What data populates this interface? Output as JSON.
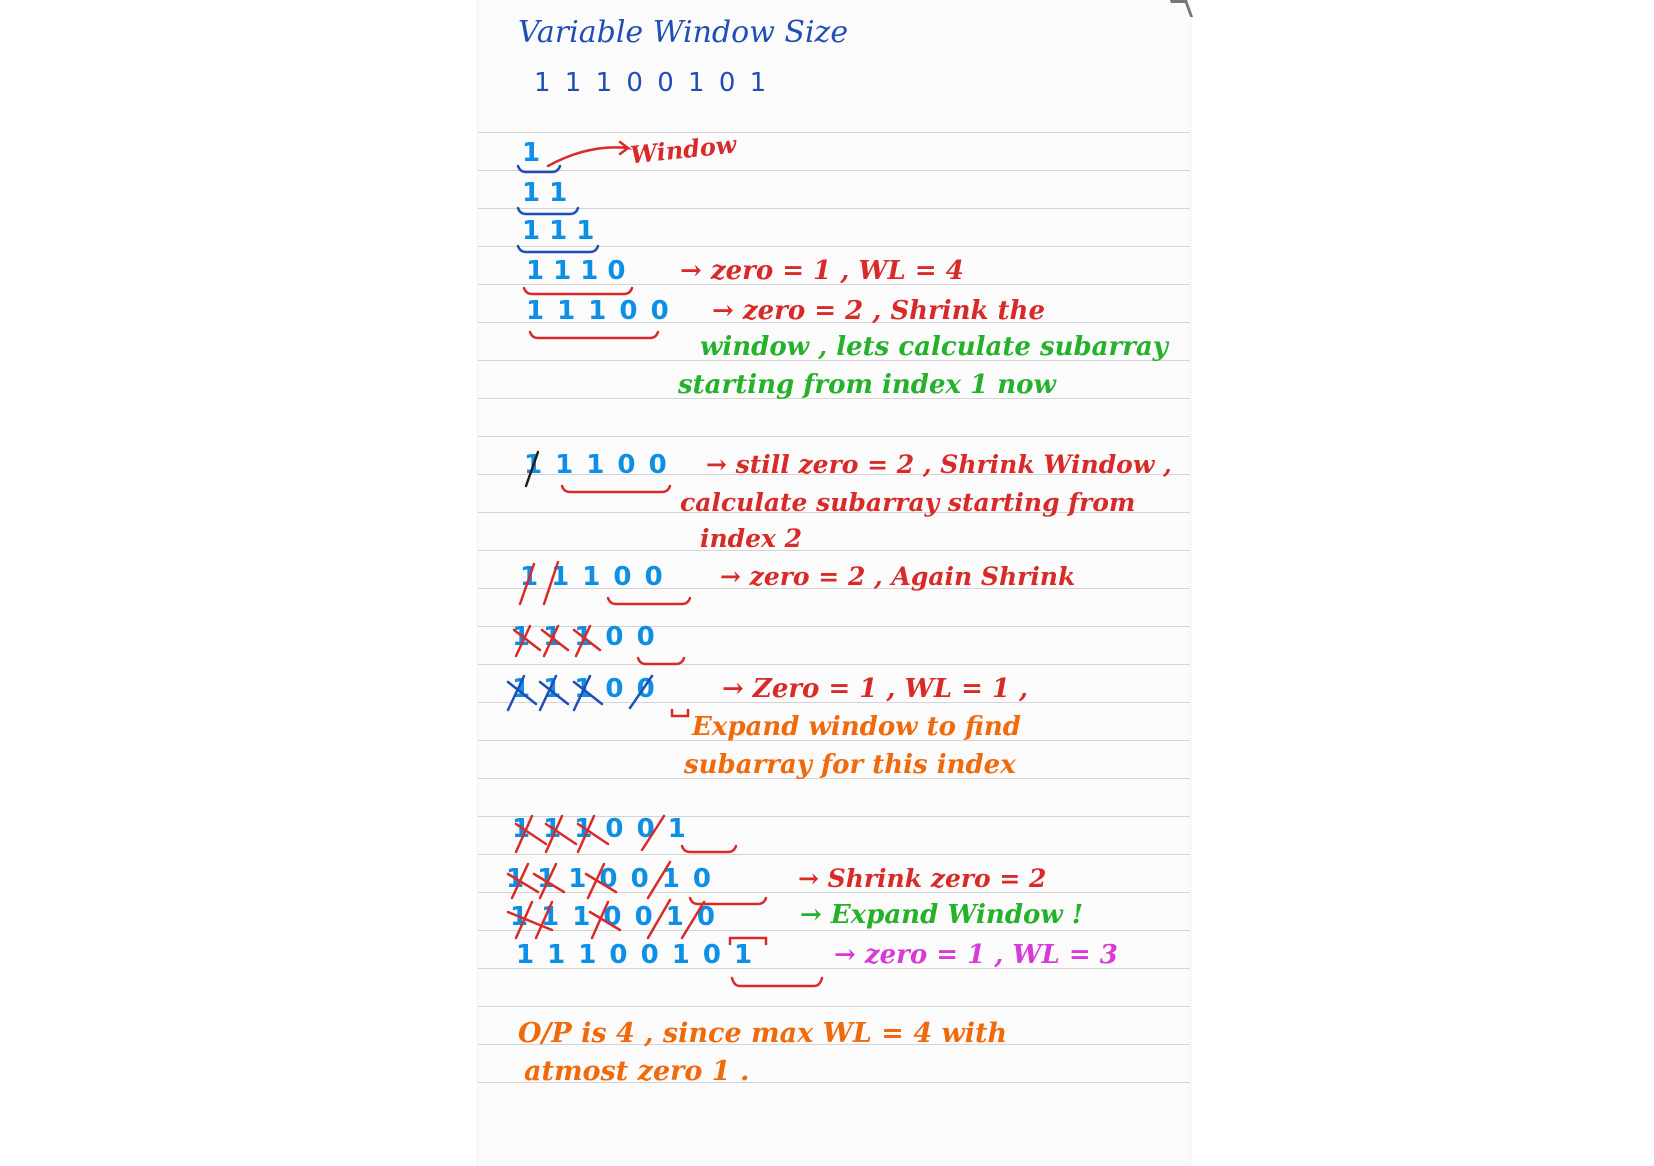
{
  "title": "Variable Window Size",
  "input_sequence": "1 1 1 0 0 1 0 1",
  "rows": [
    {
      "seq": "1",
      "note": "Window"
    },
    {
      "seq": "1 1"
    },
    {
      "seq": "1 1 1"
    },
    {
      "seq": "1 1 1 0",
      "note": "→ zero = 1 , WL = 4"
    },
    {
      "seq": "1 1 1 0 0",
      "note": "→ zero = 2 , Shrink the",
      "note2": "window , lets calculate subarray",
      "note3": "starting from index 1 now"
    },
    {
      "seq": "1 1 1 0 0",
      "note": "→ still zero = 2 , Shrink Window ,",
      "note2": "calculate subarray starting from",
      "note3": "index 2"
    },
    {
      "seq": "1 1 1 0 0",
      "note": "→ zero = 2 , Again Shrink"
    },
    {
      "seq": "1 1 1 0 0"
    },
    {
      "seq": "1 1 1 0 0",
      "note": "→ Zero = 1 , WL = 1 ,",
      "note2": "Expand window to find",
      "note3": "subarray for this index"
    },
    {
      "seq": "1 1 1 0 0 1"
    },
    {
      "seq": "1 1 1 0 0 1 0",
      "note": "→ Shrink zero = 2"
    },
    {
      "seq": "1 1 1 0 0 1 0",
      "note": "→ Expand Window !"
    },
    {
      "seq": "1 1 1 0 0 1 0 1",
      "note": "→ zero = 1 , WL = 3"
    }
  ],
  "conclusion_line1": "O/P is 4 , since max WL = 4 with",
  "conclusion_line2": "atmost zero 1 .",
  "colors": {
    "blue": "#0e8fe6",
    "navy": "#1f4fb5",
    "red": "#d82a28",
    "green": "#25b22a",
    "orange": "#f06a0c",
    "magenta": "#d83ad8"
  }
}
